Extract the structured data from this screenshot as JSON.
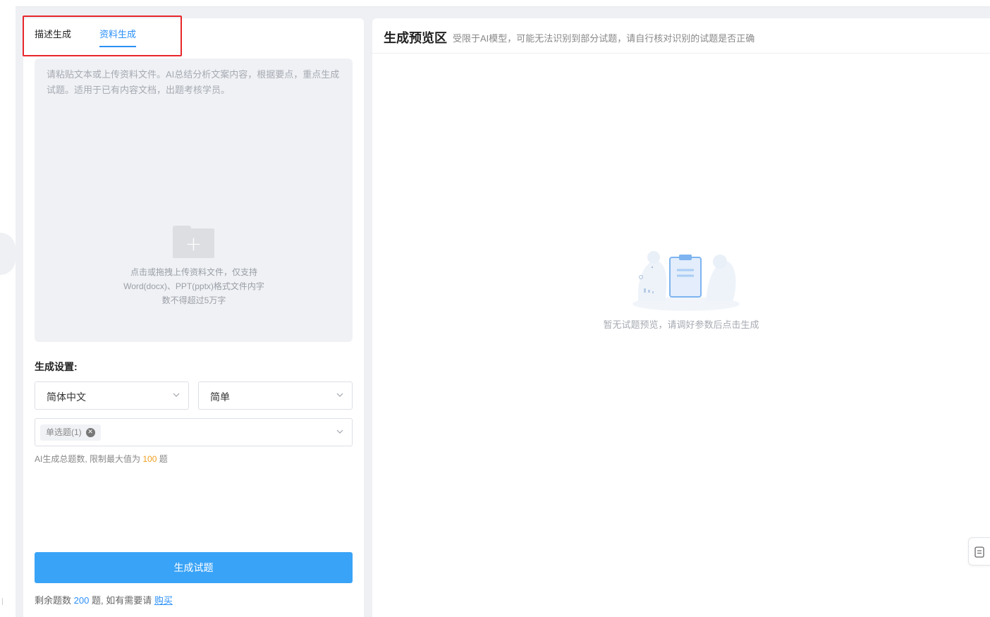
{
  "tabs": [
    {
      "label": "描述生成",
      "active": false
    },
    {
      "label": "资料生成",
      "active": true
    }
  ],
  "upload": {
    "description": "请粘贴文本或上传资料文件。AI总结分析文案内容，根据要点，重点生成试题。适用于已有内容文档，出题考核学员。",
    "hint_lines": [
      "点击或拖拽上传资料文件，仅支持",
      "Word(docx)、PPT(pptx)格式文件内字",
      "数不得超过5万字"
    ]
  },
  "settings": {
    "label": "生成设置:",
    "language": "简体中文",
    "difficulty": "简单",
    "question_type_tag": "单选题(1)",
    "limit_prefix": "AI生成总题数, 限制最大值为",
    "limit_value": "100",
    "limit_suffix": "题"
  },
  "generate_button": "生成试题",
  "remaining": {
    "prefix": "剩余题数",
    "count": "200",
    "middle": "题, 如有需要请",
    "buy_link": "购买"
  },
  "preview": {
    "title": "生成预览区",
    "subtitle": "受限于AI模型，可能无法识别到部分试题，请自行核对识别的试题是否正确",
    "empty_text": "暂无试题预览，请调好参数后点击生成"
  },
  "colors": {
    "accent": "#2b8ff7",
    "button": "#39a3f7",
    "highlight_border": "#e8262b",
    "limit_number": "#f0a020"
  },
  "icons": [
    "folder-upload-icon",
    "chevron-down-icon",
    "tag-close-icon",
    "empty-clipboard-illustration",
    "document-icon"
  ]
}
